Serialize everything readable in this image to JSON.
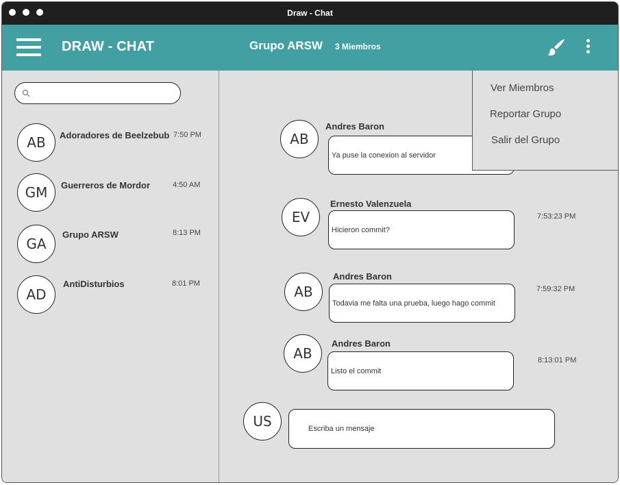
{
  "window": {
    "title": "Draw - Chat"
  },
  "header": {
    "app_title": "DRAW - CHAT",
    "group_name": "Grupo ARSW",
    "member_count": "3 Miembros",
    "accent": "#42a0a3",
    "icons": [
      "menu-icon",
      "brush-icon",
      "more-vertical-icon"
    ]
  },
  "search": {
    "value": "",
    "placeholder": "",
    "icon": "search-icon"
  },
  "conversations": [
    {
      "initials": "AB",
      "name": "Adoradores de Beelzebub",
      "time": "7:50 PM"
    },
    {
      "initials": "GM",
      "name": "Guerreros de Mordor",
      "time": "4:50 AM"
    },
    {
      "initials": "GA",
      "name": "Grupo ARSW",
      "time": "8:13 PM"
    },
    {
      "initials": "AD",
      "name": "AntiDisturbios",
      "time": "8:01 PM"
    }
  ],
  "messages": [
    {
      "initials": "AB",
      "sender": "Andres Baron",
      "text": "Ya puse la conexion al servidor",
      "time": ""
    },
    {
      "initials": "EV",
      "sender": "Ernesto Valenzuela",
      "text": "Hicieron commit?",
      "time": "7:53:23 PM"
    },
    {
      "initials": "AB",
      "sender": "Andres Baron",
      "text": "Todavia me falta una prueba, luego hago commit",
      "time": "7:59:32 PM"
    },
    {
      "initials": "AB",
      "sender": "Andres Baron",
      "text": "Listo el commit",
      "time": "8:13:01 PM"
    }
  ],
  "composer": {
    "initials": "US",
    "placeholder": "Escriba un mensaje",
    "value": ""
  },
  "menu": {
    "items": [
      {
        "label": "Ver Miembros"
      },
      {
        "label": "Reportar Grupo"
      },
      {
        "label": "Salir del Grupo"
      }
    ]
  }
}
